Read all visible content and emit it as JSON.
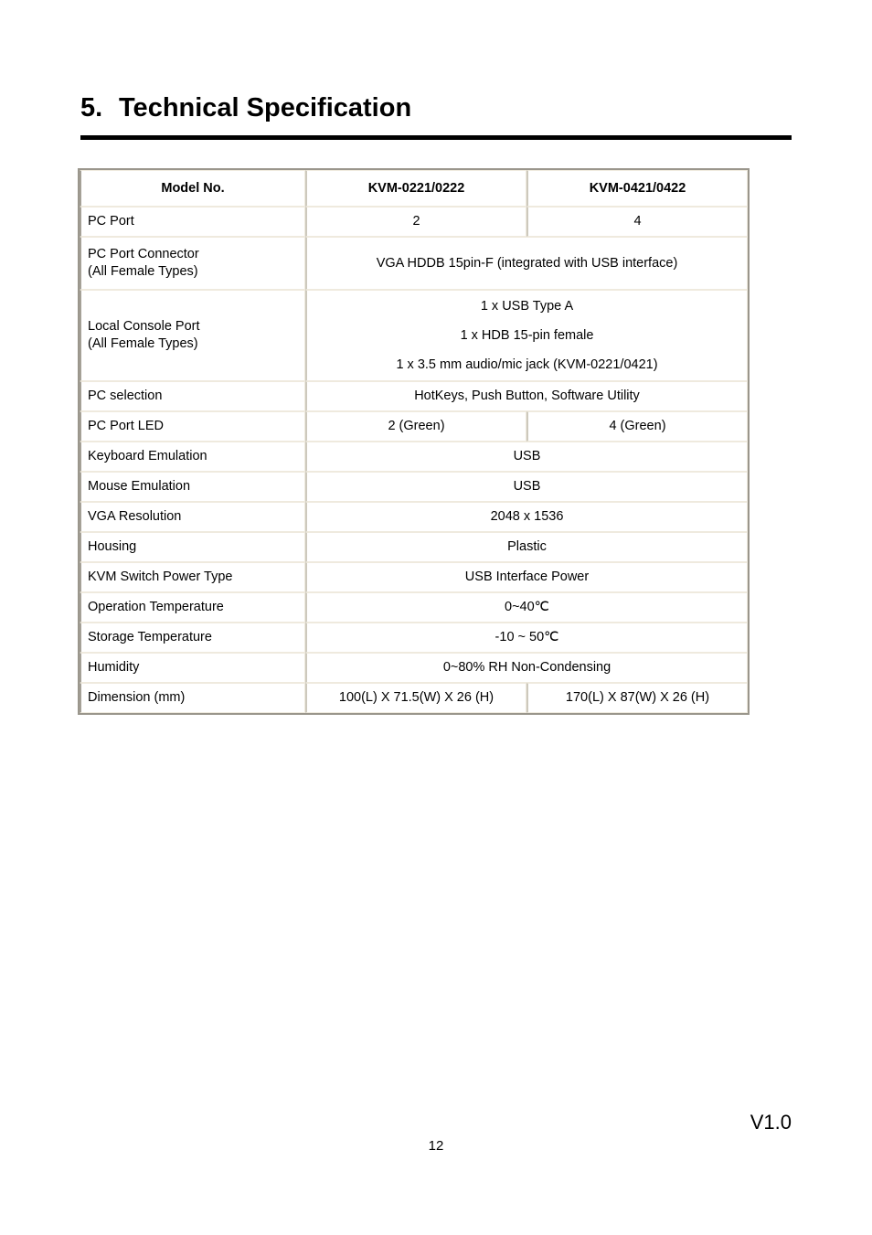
{
  "document": {
    "heading_number": "5.",
    "heading_title": "Technical Specification",
    "page_number": "12",
    "version": "V1.0"
  },
  "spec_table": {
    "header": {
      "label": "Model No.",
      "model_a": "KVM-0221/0222",
      "model_b": "KVM-0421/0422"
    },
    "rows": [
      {
        "label": "PC Port",
        "split": true,
        "value_a": "2",
        "value_b": "4"
      },
      {
        "label_line1": "PC Port Connector",
        "label_line2": "(All Female Types)",
        "split": false,
        "value": "VGA HDDB 15pin-F (integrated with USB interface)"
      },
      {
        "label_line1": "Local Console Port",
        "label_line2": "(All Female Types)",
        "split": false,
        "value_line1": "1 x USB Type A",
        "value_line2": "1 x HDB 15-pin female",
        "value_line3": "1 x 3.5 mm audio/mic jack (KVM-0221/0421)"
      },
      {
        "label": "PC selection",
        "split": false,
        "value": "HotKeys, Push Button, Software Utility"
      },
      {
        "label": "PC Port LED",
        "split": true,
        "value_a": "2 (Green)",
        "value_b": "4 (Green)"
      },
      {
        "label": "Keyboard Emulation",
        "split": false,
        "value": "USB"
      },
      {
        "label": "Mouse Emulation",
        "split": false,
        "value": "USB"
      },
      {
        "label": "VGA Resolution",
        "split": false,
        "value": "2048 x 1536"
      },
      {
        "label": "Housing",
        "split": false,
        "value": "Plastic"
      },
      {
        "label": "KVM Switch Power Type",
        "split": false,
        "value": "USB Interface Power"
      },
      {
        "label": "Operation Temperature",
        "split": false,
        "value": "0~40℃"
      },
      {
        "label": "Storage Temperature",
        "split": false,
        "value": "-10 ~ 50℃"
      },
      {
        "label": "Humidity",
        "split": false,
        "value": "0~80% RH Non-Condensing"
      },
      {
        "label": "Dimension (mm)",
        "split": true,
        "value_a": "100(L) X 71.5(W) X 26 (H)",
        "value_b": "170(L) X 87(W) X 26 (H)"
      }
    ]
  }
}
